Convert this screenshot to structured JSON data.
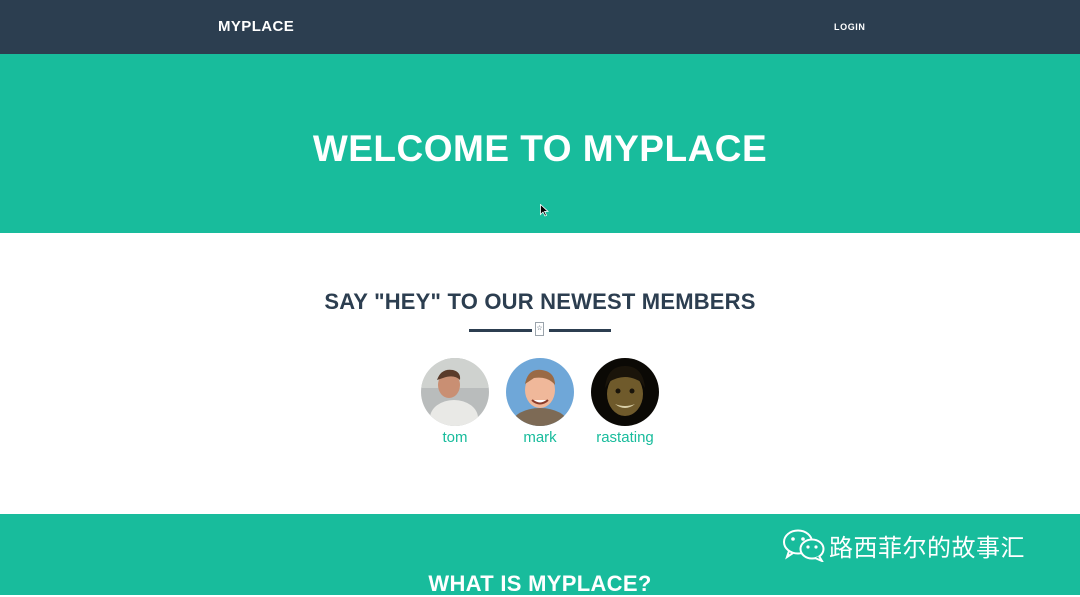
{
  "navbar": {
    "brand": "MYPLACE",
    "login_label": "LOGIN",
    "background": "#2c3e50"
  },
  "hero": {
    "title": "WELCOME TO MYPLACE",
    "background": "#18bc9c"
  },
  "members": {
    "title": "SAY \"HEY\" TO OUR NEWEST MEMBERS",
    "divider_icon": "star-icon",
    "items": [
      {
        "name": "tom",
        "avatar": "tom-avatar-photo"
      },
      {
        "name": "mark",
        "avatar": "mark-avatar-photo"
      },
      {
        "name": "rastating",
        "avatar": "rastating-avatar-photo"
      }
    ],
    "link_color": "#18bc9c"
  },
  "about": {
    "title": "WHAT IS MYPLACE?"
  },
  "watermark": {
    "text": "路西菲尔的故事汇",
    "icon": "wechat-icon"
  }
}
